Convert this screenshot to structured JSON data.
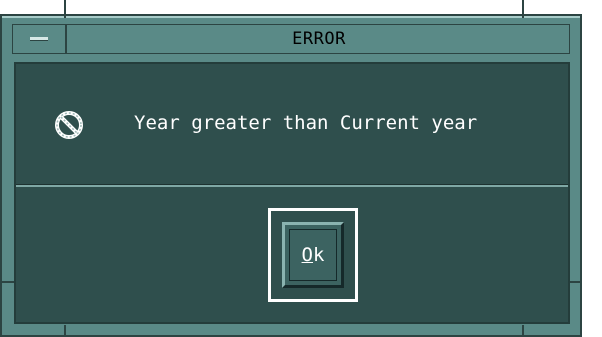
{
  "window": {
    "title": "ERROR"
  },
  "dialog": {
    "icon": "no-entry-icon",
    "message": "Year greater than Current year",
    "button": {
      "mnemonic": "O",
      "rest": "k"
    }
  },
  "colors": {
    "frame": "#5a8a87",
    "client": "#2f4f4d",
    "text": "#ffffff",
    "title_text": "#000000"
  }
}
